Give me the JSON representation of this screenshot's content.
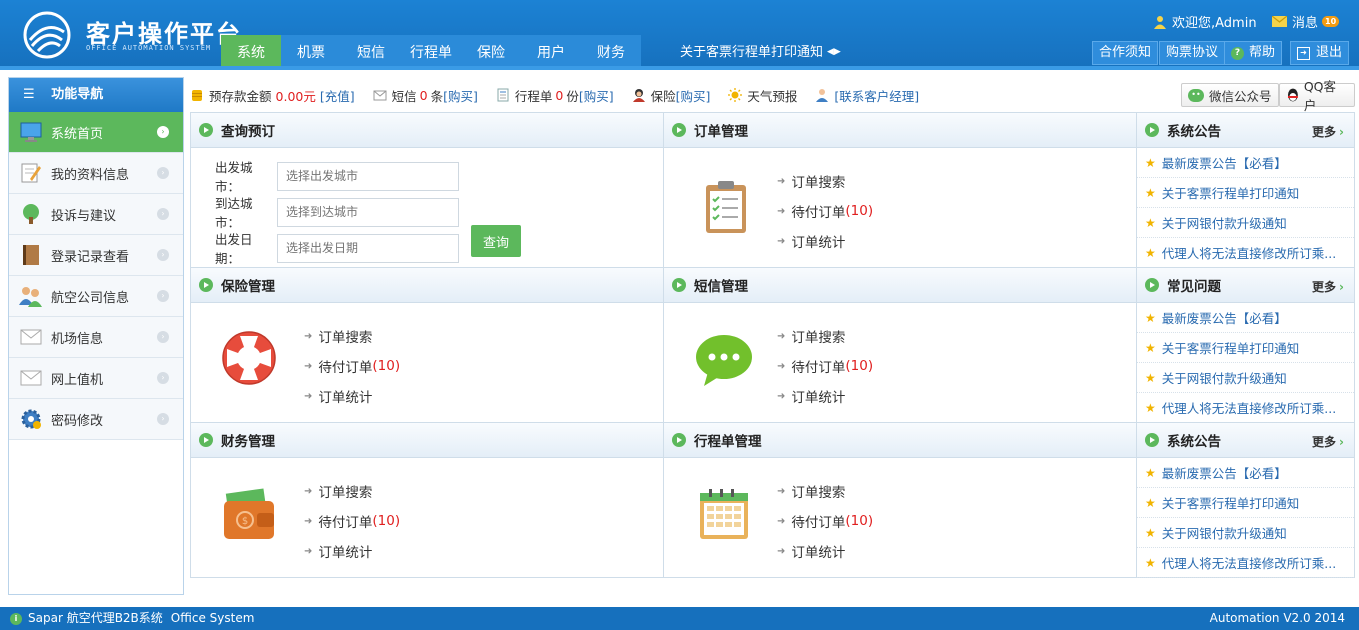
{
  "app": {
    "title": "客户操作平台",
    "subtitle": "OFFICE AUTOMATION SYSTEM"
  },
  "nav": {
    "tabs": [
      {
        "label": "系统"
      },
      {
        "label": "机票"
      },
      {
        "label": "短信"
      },
      {
        "label": "行程单"
      },
      {
        "label": "保险"
      },
      {
        "label": "用户"
      },
      {
        "label": "财务"
      }
    ],
    "active_index": 0,
    "notice": "关于客票行程单打印通知"
  },
  "header": {
    "welcome": "欢迎您,Admin",
    "messages_label": "消息",
    "messages_count": "10",
    "buttons": {
      "coop": "合作须知",
      "purchase": "购票协议",
      "help": "帮助",
      "logout": "退出"
    }
  },
  "sidebar": {
    "title": "功能导航",
    "items": [
      {
        "label": "系统首页",
        "icon": "monitor-icon"
      },
      {
        "label": "我的资料信息",
        "icon": "edit-icon"
      },
      {
        "label": "投诉与建议",
        "icon": "tree-icon"
      },
      {
        "label": "登录记录查看",
        "icon": "book-icon"
      },
      {
        "label": "航空公司信息",
        "icon": "users-icon"
      },
      {
        "label": "机场信息",
        "icon": "mail-icon"
      },
      {
        "label": "网上值机",
        "icon": "mail-icon"
      },
      {
        "label": "密码修改",
        "icon": "gear-icon"
      }
    ]
  },
  "infobar": {
    "deposit_label": "预存款金额",
    "deposit_value": "0.00元",
    "recharge": "[充值]",
    "sms_label": "短信",
    "sms_count": "0",
    "sms_unit": "条",
    "buy": "[购买]",
    "itinerary_label": "行程单",
    "itinerary_count": "0",
    "itinerary_unit": "份",
    "insurance_label": "保险",
    "weather": "天气预报",
    "contact": "[联系客户经理]",
    "wechat": "微信公众号",
    "qq": "QQ客户"
  },
  "query": {
    "title": "查询预订",
    "from_label": "出发城市：",
    "from_placeholder": "选择出发城市",
    "to_label": "到达城市：",
    "to_placeholder": "选择到达城市",
    "date_label": "出发日期：",
    "date_placeholder": "选择出发日期",
    "button": "查询"
  },
  "panels": {
    "order": {
      "title": "订单管理"
    },
    "insurance": {
      "title": "保险管理"
    },
    "sms": {
      "title": "短信管理"
    },
    "finance": {
      "title": "财务管理"
    },
    "itinerary": {
      "title": "行程单管理"
    }
  },
  "links": {
    "search": "订单搜索",
    "pending": "待付订单",
    "pending_count": "(10)",
    "stats": "订单统计"
  },
  "notices": {
    "more": "更多",
    "boxes": [
      {
        "title": "系统公告",
        "items": [
          "最新废票公告【必看】",
          "关于客票行程单打印通知",
          "关于网银付款升级通知",
          "代理人将无法直接修改所订乘..."
        ]
      },
      {
        "title": "常见问题",
        "items": [
          "最新废票公告【必看】",
          "关于客票行程单打印通知",
          "关于网银付款升级通知",
          "代理人将无法直接修改所订乘..."
        ]
      },
      {
        "title": "系统公告",
        "items": [
          "最新废票公告【必看】",
          "关于客票行程单打印通知",
          "关于网银付款升级通知",
          "代理人将无法直接修改所订乘..."
        ]
      }
    ]
  },
  "footer": {
    "left": "Sapar 航空代理B2B系统",
    "left2": "Office System",
    "right": "Automation V2.0 2014"
  },
  "colors": {
    "primary": "#1670bd",
    "accent": "#5cb85c",
    "alert": "#e02020"
  }
}
